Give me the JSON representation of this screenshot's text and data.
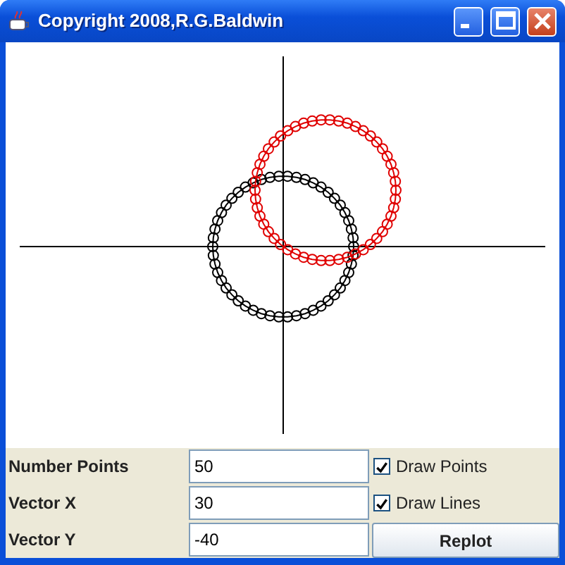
{
  "window": {
    "title": "Copyright 2008,R.G.Baldwin"
  },
  "fields": [
    {
      "label": "Number Points",
      "value": "50"
    },
    {
      "label": "Vector X",
      "value": "30"
    },
    {
      "label": "Vector Y",
      "value": "-40"
    }
  ],
  "checkboxes": [
    {
      "label": "Draw Points",
      "checked": true
    },
    {
      "label": "Draw Lines",
      "checked": true
    }
  ],
  "buttons": [
    "Replot"
  ]
}
